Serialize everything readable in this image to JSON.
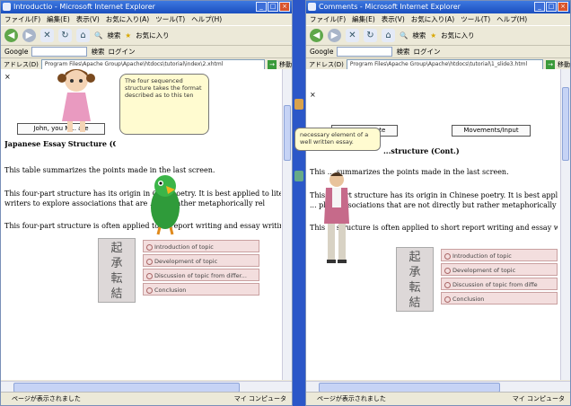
{
  "left_window": {
    "title": "Introductio - Microsoft Internet Explorer",
    "menu": [
      "ファイル(F)",
      "編集(E)",
      "表示(V)",
      "お気に入り(A)",
      "ツール(T)",
      "ヘルプ(H)"
    ],
    "toolbar_labels": {
      "search": "検索",
      "favorites": "お気に入り"
    },
    "google_label": "Google",
    "search_bar_labels": [
      "検索",
      "ログイン"
    ],
    "address_label": "アドレス(D)",
    "address_url": "Program Files\\Apache Group\\Apache\\htdocs\\tutorial\\index\\2.xhtml",
    "go_label": "移動",
    "content": {
      "x_mark": "×",
      "button_label": "John, you M... ate",
      "heading": "Japanese Essay Structure (C...",
      "para1": "This table summarizes the points made in the last screen.",
      "para2a": "This four-part structure has its origin in Ch... poetry. It is best applied to lite",
      "para2b": "writers to explore associations that are ... not rather metaphorically rel",
      "para3": "This four-part structure is often applied to ... report writing and essay writing.",
      "balloon_text": "The four sequenced structure takes the format described as to this ten",
      "diagram": {
        "kanji": [
          "起",
          "承",
          "転",
          "結"
        ],
        "rows": [
          "Introduction of topic",
          "Development of topic",
          "Discussion of topic from differ...",
          "Conclusion"
        ]
      }
    },
    "status_text": "ページが表示されました",
    "zone_text": "マイ コンピュータ"
  },
  "right_window": {
    "title": "Comments - Microsoft Internet Explorer",
    "menu": [
      "ファイル(F)",
      "編集(E)",
      "表示(V)",
      "お気に入り(A)",
      "ツール(T)",
      "ヘルプ(H)"
    ],
    "toolbar_labels": {
      "search": "検索",
      "favorites": "お気に入り"
    },
    "google_label": "Google",
    "search_bar_labels": [
      "検索",
      "ログイン"
    ],
    "address_label": "アドレス(D)",
    "address_url": "Program Files\\Apache Group\\Apache\\htdocs\\tutorial\\1_slide3.html",
    "go_label": "移動",
    "content": {
      "x_mark": "×",
      "button1": "Restate state",
      "button2": "Movements/Input",
      "heading": "...structure (Cont.)",
      "para1": "This ... summarizes the points made in the last screen.",
      "para2a": "This ... part structure has its origin in Chinese poetry. It is best applied to l",
      "para2b": "... plore associations that are not directly but rather metaphorically re",
      "para3": "This ... structure is often applied to short report writing and essay wri",
      "balloon_text": "necessary element of a well written essay.",
      "diagram": {
        "kanji": [
          "起",
          "承",
          "転",
          "結"
        ],
        "rows": [
          "Introduction of topic",
          "Development of topic",
          "Discussion of topic from diffe",
          "Conclusion"
        ]
      }
    },
    "status_text": "ページが表示されました",
    "zone_text": "マイ コンピュータ"
  },
  "colors": {
    "title_bar": "#1b4fbf",
    "balloon": "#fffbd0",
    "diagram_row": "#f3dede",
    "desktop_gap": "#2b57c8"
  }
}
